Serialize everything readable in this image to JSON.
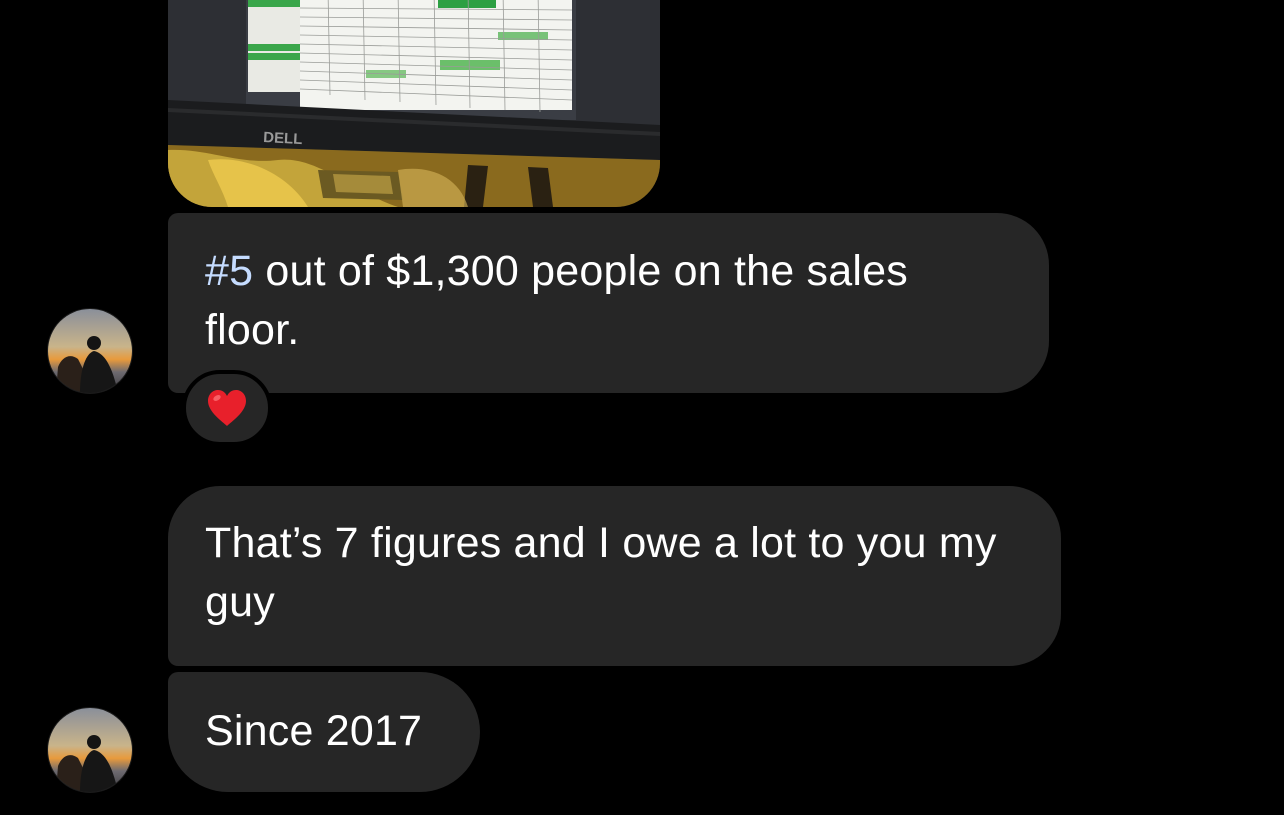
{
  "photo": {
    "brand_text": "DELL",
    "description_icon": "monitor-leaderboard-photo"
  },
  "messages": [
    {
      "hashtag": "#5",
      "text": " out of $1,300 people on the sales floor."
    },
    {
      "text": "That’s 7 figures and I owe a lot to you my guy"
    },
    {
      "text": "Since 2017"
    }
  ],
  "reaction": {
    "icon": "heart-emoji",
    "color": "#e8202b"
  },
  "colors": {
    "background": "#000000",
    "bubble": "#262626",
    "text": "#ffffff",
    "hashtag": "#c5dcff"
  }
}
